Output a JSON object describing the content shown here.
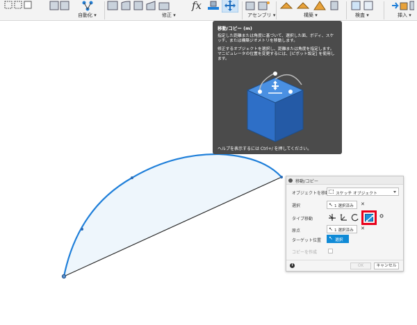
{
  "toolbar": {
    "groups": [
      {
        "label": "自動化 ▾"
      },
      {
        "label": "修正 ▾"
      },
      {
        "label": "アセンブリ ▾"
      },
      {
        "label": "構築 ▾"
      },
      {
        "label": "検査 ▾"
      },
      {
        "label": "挿入 ▾"
      }
    ],
    "fx_label": "fx"
  },
  "tooltip": {
    "title": "移動/コピー (m)",
    "paragraph1": "指定した距離または角度に基づいて、選択した面、ボディ、スケッチ、または構築ジオメトリを移動します。",
    "paragraph2": "修正するオブジェクトを選択し、距離または角度を指定します。マニピュレータの位置を変更するには、[ピボット設定] を使用します。",
    "footer": "ヘルプを表示するには Ctrl+/ を押してください。"
  },
  "dialog": {
    "title": "移動/コピー",
    "object_to_move_label": "オブジェクトを移動",
    "object_to_move_value": "スケッチ オブジェクト",
    "selection_label": "選択",
    "selection_value": "1 選択済み",
    "move_type_label": "タイプ移動",
    "origin_label": "原点",
    "origin_value": "1 選択済み",
    "target_label": "ターゲット位置",
    "target_button": "選択",
    "create_copy_label": "コピーを作成",
    "create_copy_checked": false,
    "clear_glyph": "✕",
    "cursor_glyph": "↖",
    "info_glyph": "i",
    "ok_label": "OK",
    "cancel_label": "キャンセル"
  },
  "colors": {
    "sketch_curve": "#1f7fd9",
    "sketch_fill": "#eef6fc",
    "accent": "#0f8ad6",
    "highlight": "#e8001a",
    "tooltip_bg": "#4b4b4b",
    "cube": "#2e6fc7"
  }
}
